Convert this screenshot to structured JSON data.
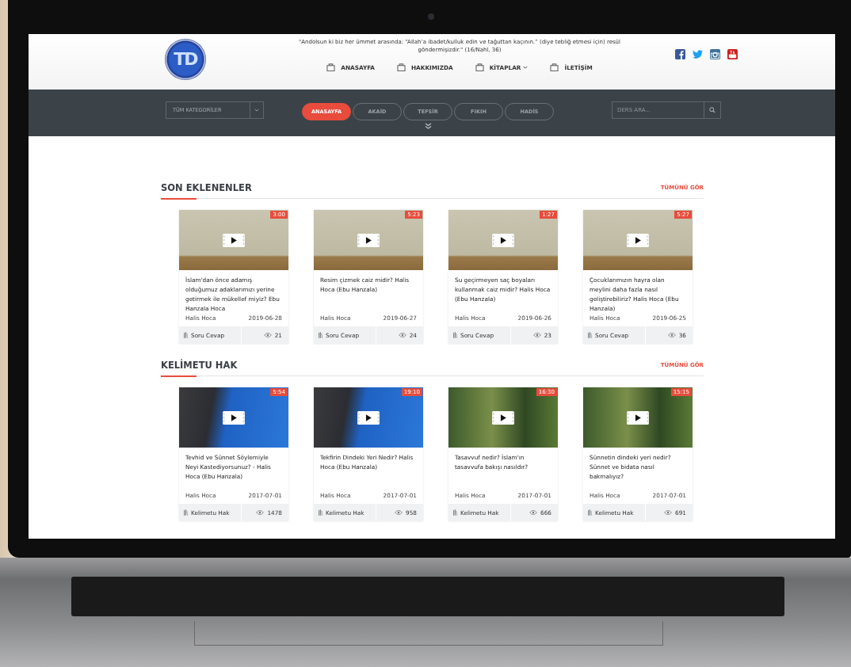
{
  "logo": {
    "text": "TD"
  },
  "quote": "\"Andolsun ki biz her ümmet arasında: “Allah’a ibadet/kulluk edin ve tağuttan kaçının.” (diye tebliğ etmesi için) resûl göndermişizdir.\" (16/Nahl, 36)",
  "menu": [
    {
      "label": "ANASAYFA",
      "dropdown": false
    },
    {
      "label": "HAKKIMIZDA",
      "dropdown": false
    },
    {
      "label": "KİTAPLAR",
      "dropdown": true
    },
    {
      "label": "İLETİŞİM",
      "dropdown": false
    }
  ],
  "category_select": {
    "value": "TÜM KATEGORİLER"
  },
  "tabs": [
    {
      "label": "ANASAYFA",
      "selected": true
    },
    {
      "label": "AKAİD",
      "selected": false
    },
    {
      "label": "TEFSİR",
      "selected": false
    },
    {
      "label": "FIKIH",
      "selected": false
    },
    {
      "label": "HADİS",
      "selected": false
    }
  ],
  "search": {
    "placeholder": "DERS ARA..."
  },
  "sections": [
    {
      "title": "SON EKLENENLER",
      "link": "TÜMÜNÜ GÖR",
      "videos": [
        {
          "kind": "studio",
          "duration": "3:00",
          "title": "İslam'dan önce adamış olduğumuz adaklarımızı yerine getirmek ile mükellef miyiz? Ebu Hanzala Hoca",
          "author": "Halis Hoca",
          "date": "2019-06-28",
          "category": "Soru Cevap",
          "views": "21"
        },
        {
          "kind": "studio",
          "duration": "5:23",
          "title": "Resim çizmek caiz midir? Halis Hoca (Ebu Hanzala)",
          "author": "Halis Hoca",
          "date": "2019-06-27",
          "category": "Soru Cevap",
          "views": "24"
        },
        {
          "kind": "studio",
          "duration": "1:27",
          "title": "Su geçirmeyen saç boyaları kullanmak caiz midir? Halis Hoca (Ebu Hanzala)",
          "author": "Halis Hoca",
          "date": "2019-06-26",
          "category": "Soru Cevap",
          "views": "23"
        },
        {
          "kind": "studio",
          "duration": "5:27",
          "title": "Çocuklarımızın hayra olan meylini daha fazla nasıl geliştirebiliriz? Halis Hoca (Ebu Hanzala)",
          "author": "Halis Hoca",
          "date": "2019-06-25",
          "category": "Soru Cevap",
          "views": "36"
        }
      ]
    },
    {
      "title": "KELİMETU HAK",
      "link": "TÜMÜNÜ GÖR",
      "videos": [
        {
          "kind": "blue",
          "duration": "5:54",
          "title": "Tevhid ve Sünnet Söylemiyle Neyi Kastediyorsunuz? - Halis Hoca (Ebu Hanzala)",
          "author": "Halis Hoca",
          "date": "2017-07-01",
          "category": "Kelimetu Hak",
          "views": "1478"
        },
        {
          "kind": "blue",
          "duration": "19:10",
          "title": "Tekfirin Dindeki Yeri Nedir? Halis Hoca (Ebu Hanzala)",
          "author": "Halis Hoca",
          "date": "2017-07-01",
          "category": "Kelimetu Hak",
          "views": "958"
        },
        {
          "kind": "garden",
          "duration": "16:30",
          "title": "Tasavvuf nedir? İslam'ın tasavvufa bakışı nasıldır?",
          "author": "Halis Hoca",
          "date": "2017-07-01",
          "category": "Kelimetu Hak",
          "views": "666"
        },
        {
          "kind": "garden",
          "duration": "15:15",
          "title": "Sünnetin dindeki yeri nedir? Sünnet ve bidata nasıl bakmalıyız?",
          "author": "Halis Hoca",
          "date": "2017-07-01",
          "category": "Kelimetu Hak",
          "views": "691"
        }
      ]
    }
  ]
}
